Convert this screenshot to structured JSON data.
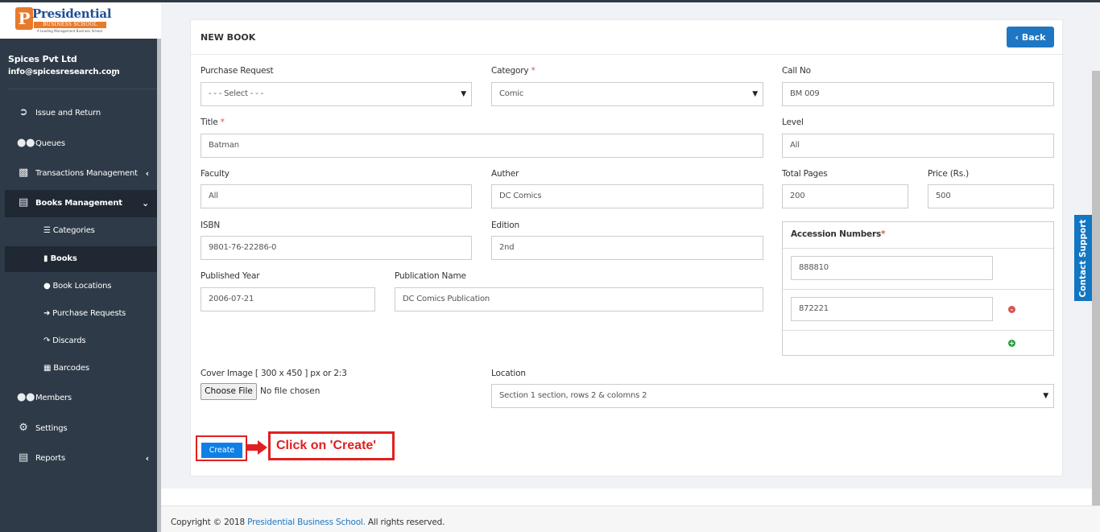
{
  "brand": {
    "name": "Presidential",
    "subtitle": "BUSINESS SCHOOL",
    "tagline": "A Leading Management Business School",
    "letter": "P"
  },
  "user": {
    "org": "Spices Pvt Ltd",
    "email": "info@spicesresearch.com"
  },
  "sidebar": {
    "items": [
      {
        "label": "Issue and Return",
        "icon": "sign-out-icon"
      },
      {
        "label": "Queues",
        "icon": "users-icon"
      },
      {
        "label": "Transactions Management",
        "icon": "money-icon"
      },
      {
        "label": "Books Management",
        "icon": "book-icon"
      },
      {
        "label": "Members",
        "icon": "users-icon"
      },
      {
        "label": "Settings",
        "icon": "gear-icon"
      },
      {
        "label": "Reports",
        "icon": "bar-chart-icon"
      }
    ],
    "sub_items": [
      {
        "label": "Categories",
        "icon": "list-icon"
      },
      {
        "label": "Books",
        "icon": "book-icon"
      },
      {
        "label": "Book Locations",
        "icon": "map-marker-icon"
      },
      {
        "label": "Purchase Requests",
        "icon": "sign-in-icon"
      },
      {
        "label": "Discards",
        "icon": "share-icon"
      },
      {
        "label": "Barcodes",
        "icon": "barcode-icon"
      }
    ]
  },
  "page": {
    "title": "NEW BOOK",
    "back_label": "Back"
  },
  "form": {
    "purchase_request": {
      "label": "Purchase Request",
      "value": "- - - Select - - -"
    },
    "category": {
      "label": "Category",
      "value": "Comic"
    },
    "call_no": {
      "label": "Call No",
      "value": "BM 009"
    },
    "title": {
      "label": "Title",
      "value": "Batman"
    },
    "level": {
      "label": "Level",
      "value": "All"
    },
    "faculty": {
      "label": "Faculty",
      "value": "All"
    },
    "auther": {
      "label": "Auther",
      "value": "DC Comics"
    },
    "total_pages": {
      "label": "Total Pages",
      "value": "200"
    },
    "price": {
      "label": "Price (Rs.)",
      "value": "500"
    },
    "isbn": {
      "label": "ISBN",
      "value": "9801-76-22286-0"
    },
    "edition": {
      "label": "Edition",
      "value": "2nd"
    },
    "published_year": {
      "label": "Published Year",
      "value": "2006-07-21"
    },
    "publication_name": {
      "label": "Publication Name",
      "value": "DC Comics Publication"
    },
    "accession_numbers": {
      "label": "Accession Numbers",
      "values": [
        "888810",
        "872221"
      ]
    },
    "cover_image": {
      "label": "Cover Image [ 300 x 450 ] px or 2:3",
      "button": "Choose File",
      "status": "No file chosen"
    },
    "location": {
      "label": "Location",
      "value": "Section 1 section, rows 2 & colomns 2"
    },
    "required_mark": "*"
  },
  "actions": {
    "create_label": "Create"
  },
  "annotation": {
    "callout": "Click on 'Create'",
    "color": "#e02020"
  },
  "footer": {
    "prefix": "Copyright © 2018",
    "link": "Presidential Business School.",
    "suffix": "All rights reserved."
  },
  "contact_tab": "Contact Support",
  "colors": {
    "sidebar_bg": "#2e3a47",
    "accent": "#1f77c3",
    "create": "#0d7fe6",
    "danger": "#d9534f",
    "success": "#2f9e44"
  }
}
